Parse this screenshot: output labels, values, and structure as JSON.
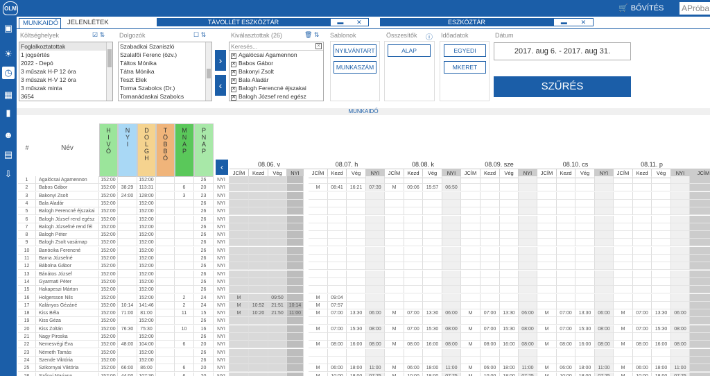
{
  "header": {
    "logo": "OLM",
    "upgrade_label": "BŐVÍTÉS",
    "user": "APróba"
  },
  "tabs": [
    {
      "label": "MUNKAIDŐ"
    },
    {
      "label": "JELENLÉTEK"
    }
  ],
  "toolbars": {
    "absence": "TÁVOLLÉT ESZKÖZTÁR",
    "tools": "ESZKÖZTÁR"
  },
  "filters": {
    "cost_centers": {
      "label": "Költséghelyek",
      "items": [
        "Foglalkoztatottak",
        "1 jogsértés",
        "2022 - Depó",
        "3 műszak H-P 12 óra",
        "3 műszak H-V 12 óra",
        "3 műszak minta",
        "3654"
      ]
    },
    "employees": {
      "label": "Dolgozók",
      "items": [
        "Szabadkai Szaniszló",
        "Szalafői Ferenc (özv.)",
        "Táltos Mónika",
        "Tátra Mónika",
        "Teszt Elek",
        "Torma Szabolcs (Dr.)",
        "Tornanádaskai Szabolcs"
      ]
    },
    "selected": {
      "label": "Kiválasztottak (26)",
      "search_placeholder": "Keresés...",
      "items": [
        "Agalócsai Agamennon",
        "Babos Gábor",
        "Bakonyi Zsolt",
        "Bala Aladár",
        "Balogh Ferencné éjszakai",
        "Balogh József rend egész"
      ]
    },
    "templates": {
      "label": "Sablonok",
      "buttons": [
        "NYILVÁNTART",
        "MUNKASZÁM"
      ]
    },
    "summaries": {
      "label": "Összesítők",
      "buttons": [
        "ALAP"
      ]
    },
    "time_data": {
      "label": "Időadatok",
      "buttons": [
        "EGYEDI",
        "MKERET"
      ]
    },
    "date": {
      "label": "Dátum",
      "range": "2017. aug 6.  -  2017. aug 31."
    },
    "filter_button": "SZŰRÉS"
  },
  "section_title": "MUNKAIDŐ",
  "grid": {
    "hash_label": "#",
    "name_label": "Név",
    "sum_cols": [
      {
        "label": "H I V Ó",
        "color": "#9be59b"
      },
      {
        "label": "N Y I",
        "color": "#a9d8f5"
      },
      {
        "label": "D O L G H",
        "color": "#f5d38f"
      },
      {
        "label": "T Ö B B Ó",
        "color": "#f0b47a"
      },
      {
        "label": "M N A P",
        "color": "#5ac85a"
      },
      {
        "label": "P N A P",
        "color": "#a8e8a8"
      }
    ],
    "days": [
      "08.06. v",
      "08.07. h",
      "08.08. k",
      "08.09. sze",
      "08.10. cs",
      "08.11. p"
    ],
    "day_cols": [
      "JCÍM",
      "Kezd",
      "Vég",
      "NYI"
    ],
    "rows": [
      [
        "1",
        "Agalócsai Agamennon",
        "152:00",
        "",
        "152:00",
        "",
        "",
        "26",
        "NYI"
      ],
      [
        "2",
        "Babos Gábor",
        "152:00",
        "38:29",
        "113:31",
        "",
        "6",
        "20",
        "NYI"
      ],
      [
        "3",
        "Bakonyi Zsolt",
        "152:00",
        "24:00",
        "128:00",
        "",
        "3",
        "23",
        "NYI"
      ],
      [
        "4",
        "Bala Aladár",
        "152:00",
        "",
        "152:00",
        "",
        "",
        "26",
        "NYI"
      ],
      [
        "5",
        "Balogh Ferencné éjszakai",
        "152:00",
        "",
        "152:00",
        "",
        "",
        "26",
        "NYI"
      ],
      [
        "6",
        "Balogh József rend egész",
        "152:00",
        "",
        "152:00",
        "",
        "",
        "26",
        "NYI"
      ],
      [
        "7",
        "Balogh Józsefné rend fél",
        "152:00",
        "",
        "152:00",
        "",
        "",
        "26",
        "NYI"
      ],
      [
        "8",
        "Balogh Péter",
        "152:00",
        "",
        "152:00",
        "",
        "",
        "26",
        "NYI"
      ],
      [
        "9",
        "Balogh Zsolt vasárnap",
        "152:00",
        "",
        "152:00",
        "",
        "",
        "26",
        "NYI"
      ],
      [
        "10",
        "Banócika Ferencné",
        "152:00",
        "",
        "152:00",
        "",
        "",
        "26",
        "NYI"
      ],
      [
        "11",
        "Barna Józsefné",
        "152:00",
        "",
        "152:00",
        "",
        "",
        "26",
        "NYI"
      ],
      [
        "12",
        "Bábolna Gábor",
        "152:00",
        "",
        "152:00",
        "",
        "",
        "26",
        "NYI"
      ],
      [
        "13",
        "Bánátos József",
        "152:00",
        "",
        "152:00",
        "",
        "",
        "26",
        "NYI"
      ],
      [
        "14",
        "Gyarmati Péter",
        "152:00",
        "",
        "152:00",
        "",
        "",
        "26",
        "NYI"
      ],
      [
        "15",
        "Hakapeszi Márton",
        "152:00",
        "",
        "152:00",
        "",
        "",
        "26",
        "NYI"
      ],
      [
        "16",
        "Holgersson Nils",
        "152:00",
        "",
        "152:00",
        "",
        "2",
        "24",
        "NYI"
      ],
      [
        "17",
        "Kalányos Gézáné",
        "152:00",
        "10:14",
        "141:46",
        "",
        "2",
        "24",
        "NYI"
      ],
      [
        "18",
        "Kiss Béla",
        "152:00",
        "71:00",
        "81:00",
        "",
        "11",
        "15",
        "NYI"
      ],
      [
        "19",
        "Kiss Géza",
        "152:00",
        "",
        "152:00",
        "",
        "",
        "26",
        "NYI"
      ],
      [
        "20",
        "Kiss Zoltán",
        "152:00",
        "76:30",
        "75:30",
        "",
        "10",
        "16",
        "NYI"
      ],
      [
        "21",
        "Nagy Piroska",
        "152:00",
        "",
        "152:00",
        "",
        "",
        "26",
        "NYI"
      ],
      [
        "22",
        "Nemesvégi Éva",
        "152:00",
        "48:00",
        "104:00",
        "",
        "6",
        "20",
        "NYI"
      ],
      [
        "23",
        "Németh Tamás",
        "152:00",
        "",
        "152:00",
        "",
        "",
        "26",
        "NYI"
      ],
      [
        "24",
        "Szende Viktória",
        "152:00",
        "",
        "152:00",
        "",
        "",
        "26",
        "NYI"
      ],
      [
        "25",
        "Szikornyai Viktória",
        "152:00",
        "66:00",
        "86:00",
        "",
        "6",
        "20",
        "NYI"
      ],
      [
        "26",
        "Szőnyi Mariann",
        "152:00",
        "44:00",
        "107:30",
        "",
        "6",
        "20",
        "NYI"
      ]
    ],
    "day_values": {
      "2": [
        [
          "",
          "",
          "",
          ""
        ],
        [
          "M",
          "08:41",
          "16:21",
          "07:39"
        ],
        [
          "M",
          "09:06",
          "15:57",
          "06:50"
        ],
        [
          "",
          "",
          "",
          ""
        ],
        [
          "",
          "",
          "",
          ""
        ],
        [
          "",
          "",
          "",
          ""
        ]
      ],
      "16": [
        [
          "M",
          "",
          "09:50",
          ""
        ],
        [
          "M",
          "09:04",
          "",
          ""
        ],
        [
          "",
          "",
          "",
          ""
        ],
        [
          "",
          "",
          "",
          ""
        ],
        [
          "",
          "",
          "",
          ""
        ],
        [
          "",
          "",
          "",
          ""
        ]
      ],
      "17": [
        [
          "M",
          "10:52",
          "21:51",
          "10:14"
        ],
        [
          "M",
          "07:57",
          "",
          ""
        ],
        [
          "",
          "",
          "",
          ""
        ],
        [
          "",
          "",
          "",
          ""
        ],
        [
          "",
          "",
          "",
          ""
        ],
        [
          "",
          "",
          "",
          ""
        ]
      ],
      "18": [
        [
          "M",
          "10:20",
          "21:50",
          "11:00"
        ],
        [
          "M",
          "07:00",
          "13:30",
          "06:00"
        ],
        [
          "M",
          "07:00",
          "13:30",
          "06:00"
        ],
        [
          "M",
          "07:00",
          "13:30",
          "06:00"
        ],
        [
          "M",
          "07:00",
          "13:30",
          "06:00"
        ],
        [
          "M",
          "07:00",
          "13:30",
          "06:00"
        ]
      ],
      "20": [
        [
          "",
          "",
          "",
          ""
        ],
        [
          "M",
          "07:00",
          "15:30",
          "08:00"
        ],
        [
          "M",
          "07:00",
          "15:30",
          "08:00"
        ],
        [
          "M",
          "07:00",
          "15:30",
          "08:00"
        ],
        [
          "M",
          "07:00",
          "15:30",
          "08:00"
        ],
        [
          "M",
          "07:00",
          "15:30",
          "08:00"
        ]
      ],
      "22": [
        [
          "",
          "",
          "",
          ""
        ],
        [
          "M",
          "08:00",
          "16:00",
          "08:00"
        ],
        [
          "M",
          "08:00",
          "16:00",
          "08:00"
        ],
        [
          "M",
          "08:00",
          "16:00",
          "08:00"
        ],
        [
          "M",
          "08:00",
          "16:00",
          "08:00"
        ],
        [
          "M",
          "08:00",
          "16:00",
          "08:00"
        ]
      ],
      "25": [
        [
          "",
          "",
          "",
          ""
        ],
        [
          "M",
          "06:00",
          "18:00",
          "11:00"
        ],
        [
          "M",
          "06:00",
          "18:00",
          "11:00"
        ],
        [
          "M",
          "06:00",
          "18:00",
          "11:00"
        ],
        [
          "M",
          "06:00",
          "18:00",
          "11:00"
        ],
        [
          "M",
          "06:00",
          "18:00",
          "11:00"
        ]
      ],
      "26": [
        [
          "",
          "",
          "",
          ""
        ],
        [
          "M",
          "10:00",
          "18:00",
          "07:25"
        ],
        [
          "M",
          "10:00",
          "18:00",
          "07:25"
        ],
        [
          "M",
          "10:00",
          "18:00",
          "07:25"
        ],
        [
          "M",
          "10:00",
          "18:00",
          "07:25"
        ],
        [
          "M",
          "10:00",
          "18:00",
          "07:25"
        ]
      ]
    }
  }
}
